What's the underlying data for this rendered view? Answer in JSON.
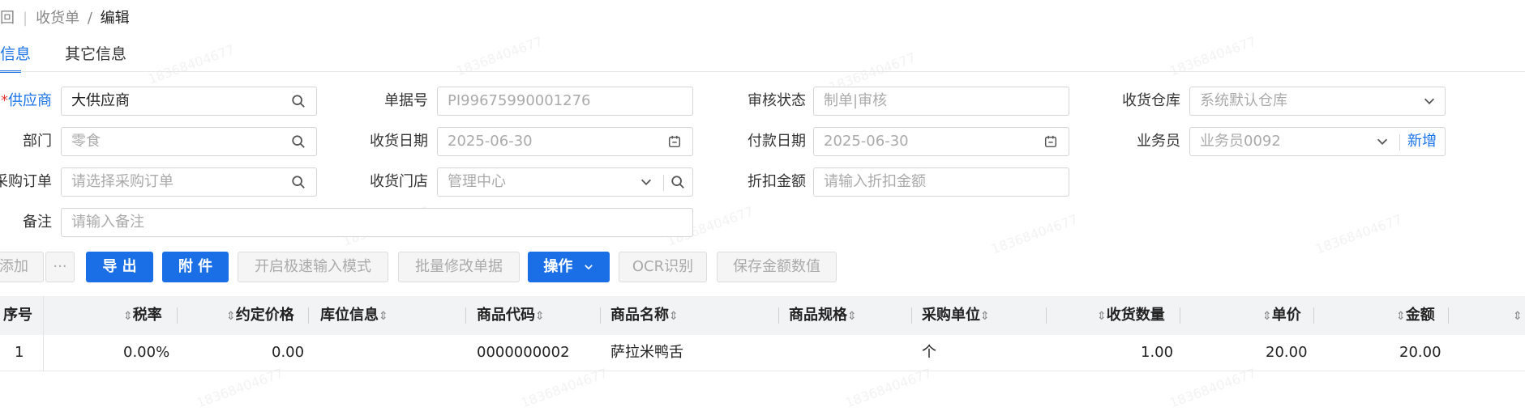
{
  "breadcrumb": {
    "back": "回",
    "parent": "收货单",
    "separator": "/",
    "current": "编辑"
  },
  "tabs": [
    {
      "label": "信息",
      "active": true
    },
    {
      "label": "其它信息",
      "active": false
    }
  ],
  "watermark": "18368404677",
  "form": {
    "supplier": {
      "label": "供应商",
      "value": "大供应商"
    },
    "doc_no": {
      "label": "单据号",
      "value": "PI99675990001276"
    },
    "audit_status": {
      "label": "审核状态",
      "value": "制单|审核"
    },
    "warehouse": {
      "label": "收货仓库",
      "value": "系统默认仓库"
    },
    "department": {
      "label": "部门",
      "value": "零食"
    },
    "receive_date": {
      "label": "收货日期",
      "value": "2025-06-30"
    },
    "pay_date": {
      "label": "付款日期",
      "value": "2025-06-30"
    },
    "salesman": {
      "label": "业务员",
      "value": "业务员0092",
      "add": "新增"
    },
    "purchase_order": {
      "label": "采购订单",
      "placeholder": "请选择采购订单"
    },
    "store": {
      "label": "收货门店",
      "value": "管理中心"
    },
    "discount": {
      "label": "折扣金额",
      "placeholder": "请输入折扣金额"
    },
    "remark": {
      "label": "备注",
      "placeholder": "请输入备注"
    }
  },
  "toolbar": {
    "add": "添加",
    "more": "···",
    "export": "导 出",
    "attach": "附 件",
    "fast_input": "开启极速输入模式",
    "batch_edit": "批量修改单据",
    "ops": "操作",
    "ocr": "OCR识别",
    "save_amount": "保存金额数值"
  },
  "table": {
    "headers": {
      "seq": "序号",
      "tax": "税率",
      "price": "约定价格",
      "location": "库位信息",
      "code": "商品代码",
      "name": "商品名称",
      "spec": "商品规格",
      "unit": "采购单位",
      "qty": "收货数量",
      "unit_price": "单价",
      "amount": "金额"
    },
    "rows": [
      {
        "seq": "1",
        "tax": "0.00%",
        "price": "0.00",
        "location": "",
        "code": "0000000002",
        "name": "萨拉米鸭舌",
        "spec": "",
        "unit": "个",
        "qty": "1.00",
        "unit_price": "20.00",
        "amount": "20.00"
      }
    ]
  },
  "colors": {
    "primary": "#1a6fe6",
    "link": "#1a73e8",
    "required": "#e53935"
  }
}
